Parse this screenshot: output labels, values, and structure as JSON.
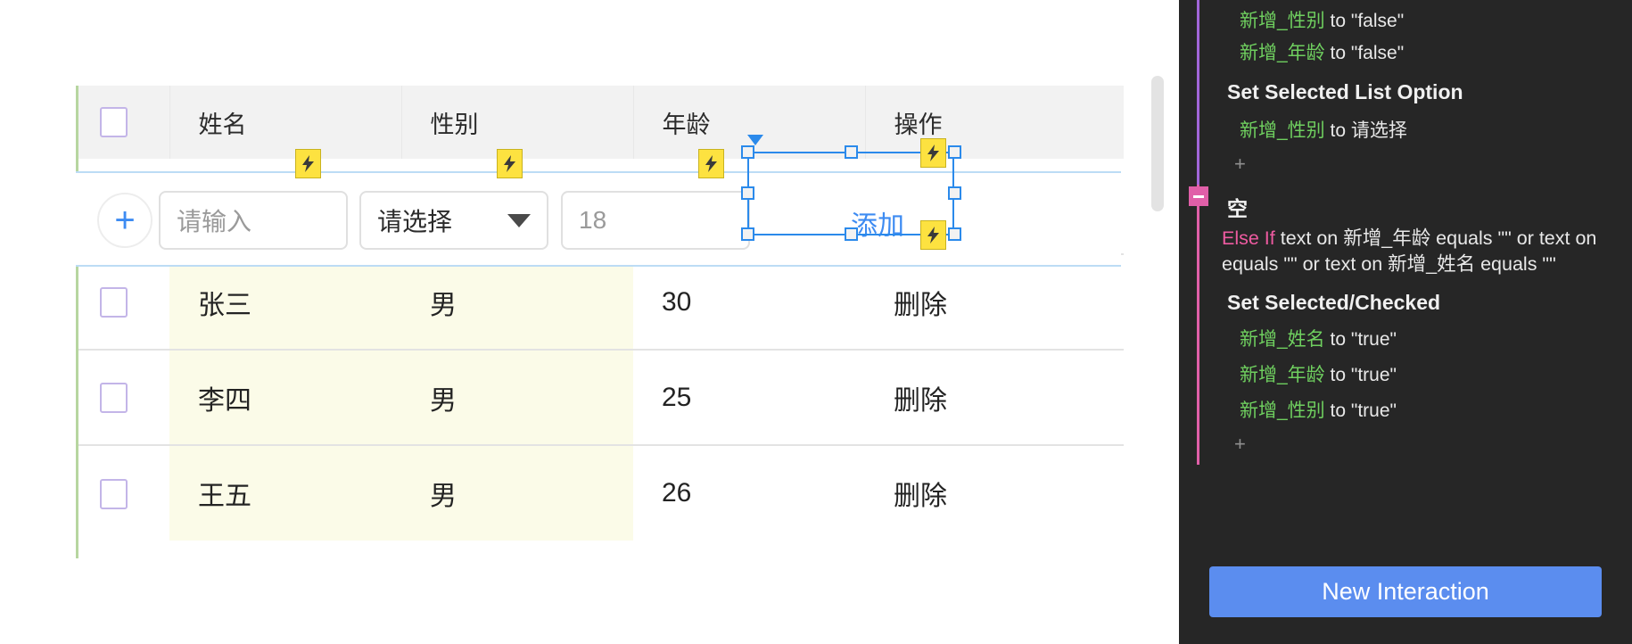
{
  "table": {
    "columns": [
      "",
      "姓名",
      "性别",
      "年龄",
      "操作"
    ],
    "header_checkbox": "checkbox-unchecked",
    "new_row": {
      "add_icon": "plus-icon",
      "name_placeholder": "请输入",
      "gender_value": "请选择",
      "age_placeholder": "18",
      "action_label": "添加"
    },
    "rows": [
      {
        "name": "张三",
        "gender": "男",
        "age": "30",
        "action": "删除"
      },
      {
        "name": "李四",
        "gender": "男",
        "age": "25",
        "action": "删除"
      },
      {
        "name": "王五",
        "gender": "男",
        "age": "26",
        "action": "删除"
      }
    ]
  },
  "panel": {
    "top_actions": [
      {
        "target": "新增_性别",
        "to": "to",
        "value": "\"false\""
      },
      {
        "target": "新增_年龄",
        "to": "to",
        "value": "\"false\""
      }
    ],
    "set_list_option_title": "Set Selected List Option",
    "list_option_action": {
      "target": "新增_性别",
      "to": "to",
      "value": "请选择"
    },
    "add_row_1": "+",
    "group": {
      "title": "空",
      "toggle": "collapse-minus-icon",
      "condition_keyword": "Else If",
      "condition_text": " text on 新增_年龄 equals \"\" or text on  equals \"\" or text on 新增_姓名 equals \"\"",
      "action_title": "Set Selected/Checked",
      "actions": [
        {
          "target": "新增_姓名",
          "to": "to",
          "value": "\"true\""
        },
        {
          "target": "新增_年龄",
          "to": "to",
          "value": "\"true\""
        },
        {
          "target": "新增_性别",
          "to": "to",
          "value": "\"true\""
        }
      ],
      "add_row": "+"
    },
    "new_interaction_label": "New Interaction"
  },
  "colors": {
    "accent_blue": "#3d8bf2",
    "button_blue": "#5b8def",
    "delete_red": "#e8493f",
    "bolt_yellow": "#fde240",
    "green_token": "#6fcf5f",
    "pink_token": "#ef5ba1",
    "row_highlight": "#fbfbe8",
    "panel_bg": "#262626"
  }
}
